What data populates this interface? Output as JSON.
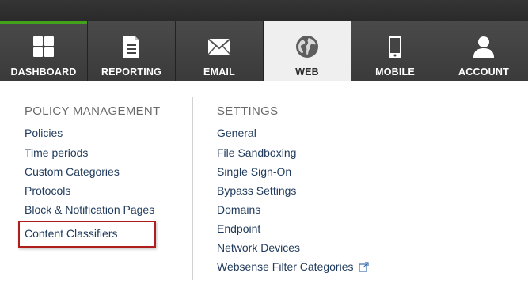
{
  "nav": {
    "tabs": [
      {
        "label": "DASHBOARD",
        "icon": "dashboard-grid-icon"
      },
      {
        "label": "REPORTING",
        "icon": "document-icon"
      },
      {
        "label": "EMAIL",
        "icon": "envelope-icon"
      },
      {
        "label": "WEB",
        "icon": "globe-icon",
        "active": true
      },
      {
        "label": "MOBILE",
        "icon": "mobile-phone-icon"
      },
      {
        "label": "ACCOUNT",
        "icon": "user-icon"
      }
    ]
  },
  "menu": {
    "policy_management": {
      "heading": "POLICY MANAGEMENT",
      "items": [
        "Policies",
        "Time periods",
        "Custom Categories",
        "Protocols",
        "Block & Notification Pages",
        "Content Classifiers"
      ]
    },
    "settings": {
      "heading": "SETTINGS",
      "items": [
        "General",
        "File Sandboxing",
        "Single Sign-On",
        "Bypass Settings",
        "Domains",
        "Endpoint",
        "Network Devices",
        "Websense Filter Categories"
      ]
    }
  },
  "colors": {
    "nav_bg": "#3a3a3a",
    "active_tab_bg": "#efefef",
    "accent_green": "#43a21c",
    "link": "#1f3a5c",
    "highlight_red": "#b01d1d"
  }
}
